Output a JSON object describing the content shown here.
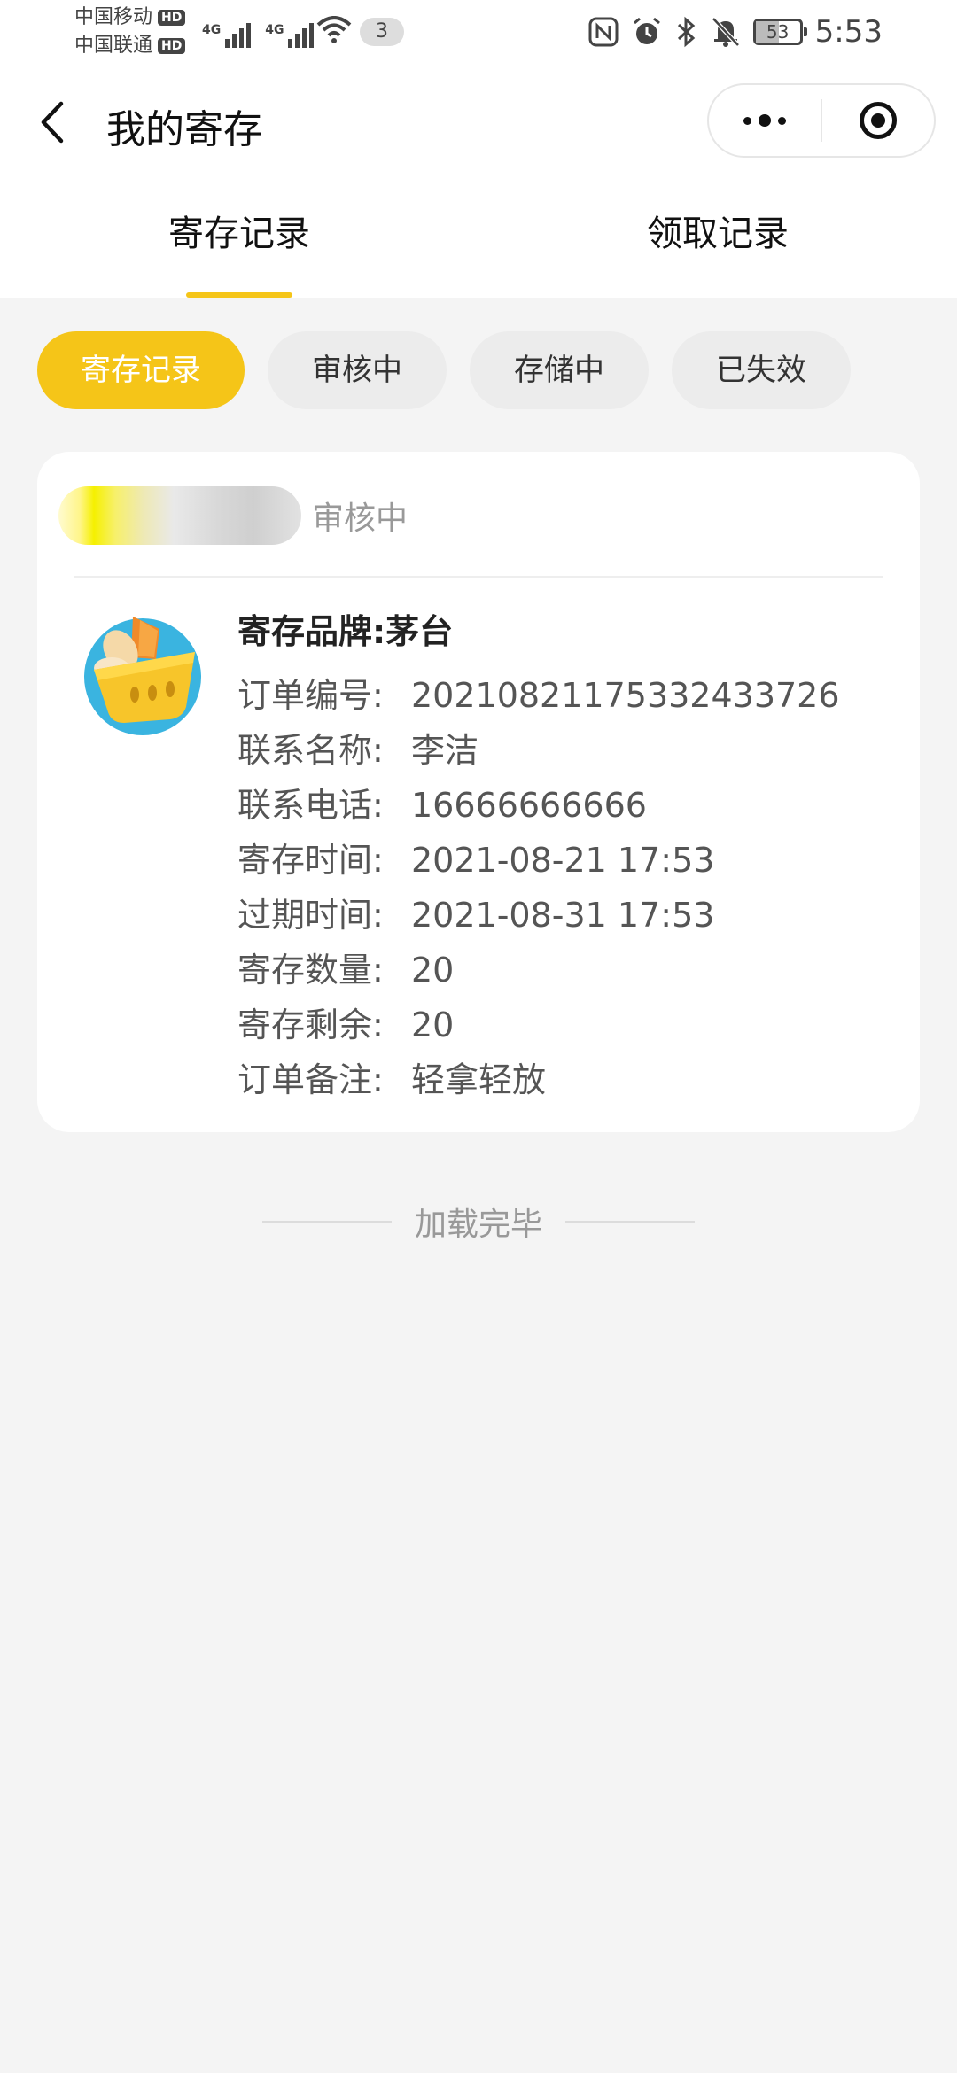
{
  "status_bar": {
    "carrier_1": "中国移动",
    "carrier_2": "中国联通",
    "hd_badge": "HD",
    "network_tag": "4G",
    "notification_count": "3",
    "battery": "53",
    "time": "5:53"
  },
  "nav": {
    "title": "我的寄存"
  },
  "tabs": [
    {
      "label": "寄存记录",
      "active": true
    },
    {
      "label": "领取记录",
      "active": false
    }
  ],
  "filters": [
    {
      "label": "寄存记录",
      "active": true
    },
    {
      "label": "审核中",
      "active": false
    },
    {
      "label": "存储中",
      "active": false
    },
    {
      "label": "已失效",
      "active": false
    }
  ],
  "order": {
    "status": "审核中",
    "brand_label": "寄存品牌:",
    "brand_value": "茅台",
    "fields": [
      {
        "label": "订单编号:",
        "value": "20210821175332433726"
      },
      {
        "label": "联系名称:",
        "value": "李洁"
      },
      {
        "label": "联系电话:",
        "value": "16666666666"
      },
      {
        "label": "寄存时间:",
        "value": "2021-08-21 17:53"
      },
      {
        "label": "过期时间:",
        "value": "2021-08-31 17:53"
      },
      {
        "label": "寄存数量:",
        "value": "20"
      },
      {
        "label": "寄存剩余:",
        "value": "20"
      },
      {
        "label": "订单备注:",
        "value": "轻拿轻放"
      }
    ]
  },
  "footer": {
    "load_done": "加载完毕"
  },
  "colors": {
    "accent": "#f5c518",
    "background": "#f4f4f4"
  }
}
